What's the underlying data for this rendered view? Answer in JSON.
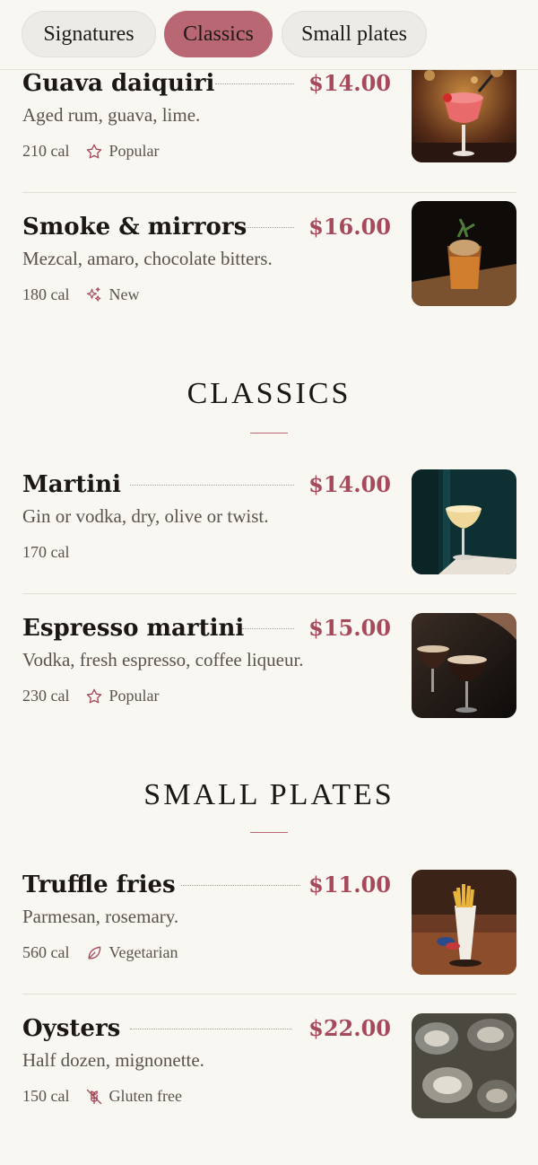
{
  "tabs": [
    {
      "label": "Signatures",
      "active": false
    },
    {
      "label": "Classics",
      "active": true
    },
    {
      "label": "Small plates",
      "active": false
    }
  ],
  "colors": {
    "accent": "#b96772",
    "price": "#a6495b",
    "background": "#f9f7f2"
  },
  "signatures": {
    "items": [
      {
        "name": "Guava daiquiri",
        "price": "$14.00",
        "desc": "Aged rum, guava, lime.",
        "cal": "210 cal",
        "tag": "Popular",
        "tag_icon": "star-icon"
      },
      {
        "name": "Smoke & mirrors",
        "price": "$16.00",
        "desc": "Mezcal, amaro, chocolate bitters.",
        "cal": "180 cal",
        "tag": "New",
        "tag_icon": "sparkle-icon"
      }
    ]
  },
  "classics": {
    "title": "CLASSICS",
    "items": [
      {
        "name": "Martini",
        "price": "$14.00",
        "desc": "Gin or vodka, dry, olive or twist.",
        "cal": "170 cal"
      },
      {
        "name": "Espresso martini",
        "price": "$15.00",
        "desc": "Vodka, fresh espresso, coffee liqueur.",
        "cal": "230 cal",
        "tag": "Popular",
        "tag_icon": "star-icon"
      }
    ]
  },
  "small_plates": {
    "title": "SMALL PLATES",
    "items": [
      {
        "name": "Truffle fries",
        "price": "$11.00",
        "desc": "Parmesan, rosemary.",
        "cal": "560 cal",
        "tag": "Vegetarian",
        "tag_icon": "leaf-icon"
      },
      {
        "name": "Oysters",
        "price": "$22.00",
        "desc": "Half dozen, mignonette.",
        "cal": "150 cal",
        "tag": "Gluten free",
        "tag_icon": "wheat-off-icon"
      }
    ]
  }
}
